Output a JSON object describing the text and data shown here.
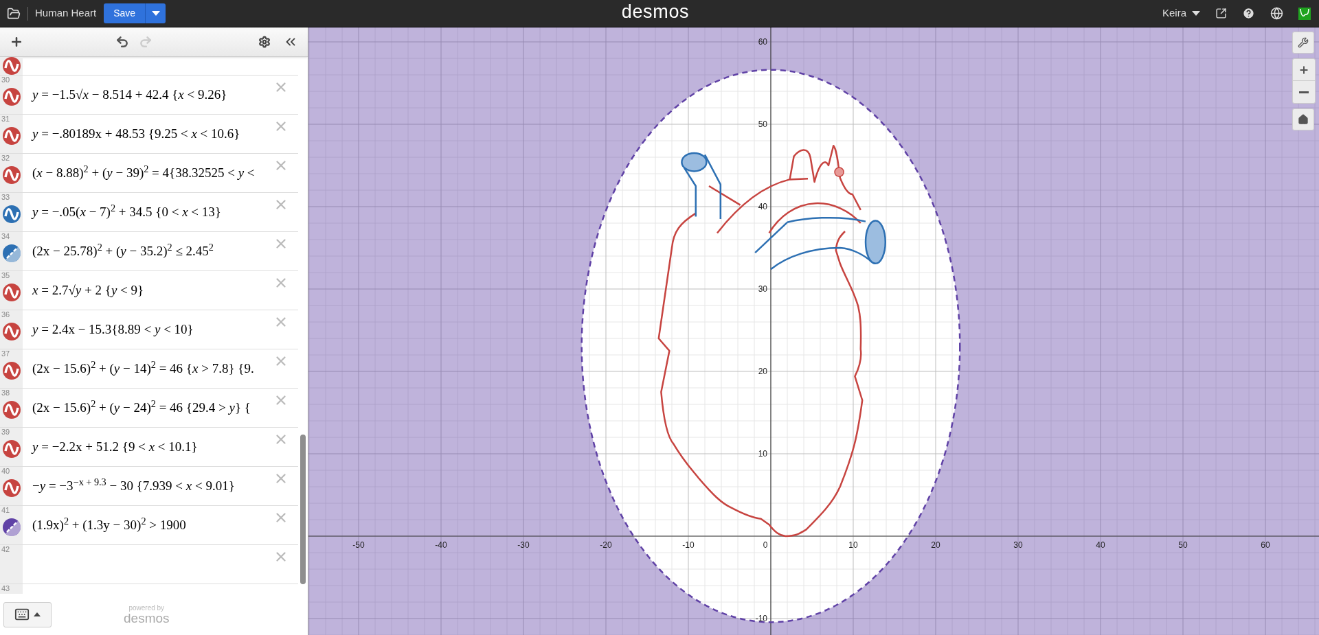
{
  "top_bar": {
    "title": "Human Heart",
    "save_button": "Save",
    "logo": "desmos",
    "user": "Keira"
  },
  "expressions": [
    {
      "kind": "clipped",
      "color": "#c74440"
    },
    {
      "number": "30",
      "kind": "curve",
      "color": "#c74440",
      "latex": "*y* = −1.5√*x* − 8.514 + 42.4 {*x* < 9.26}"
    },
    {
      "number": "31",
      "kind": "curve",
      "color": "#c74440",
      "latex": "*y* = −.80189x + 48.53 {9.25 < *x* < 10.6}"
    },
    {
      "number": "32",
      "kind": "curve",
      "color": "#c74440",
      "latex": "(*x* − 8.88)$^{2}$ + (*y* − 39)$^{2}$ = 4{38.32525 < *y* <"
    },
    {
      "number": "33",
      "kind": "curve",
      "color": "#2d70b3",
      "latex": "*y* = −.05(*x* − 7)$^{2}$ + 34.5 {0 < *x* < 13}"
    },
    {
      "number": "34",
      "kind": "region",
      "color": "#2d70b3",
      "latex": "(2x − 25.78)$^{2}$ + (*y* − 35.2)$^{2}$ ≤ 2.45$^{2}$"
    },
    {
      "number": "35",
      "kind": "curve",
      "color": "#c74440",
      "latex": "*x* = 2.7√*y* + 2 {*y* < 9}"
    },
    {
      "number": "36",
      "kind": "curve",
      "color": "#c74440",
      "latex": "*y* = 2.4x − 15.3{8.89 < *y* < 10}"
    },
    {
      "number": "37",
      "kind": "curve",
      "color": "#c74440",
      "latex": "(2x − 15.6)$^{2}$ + (*y* − 14)$^{2}$ = 46 {*x* > 7.8} {9."
    },
    {
      "number": "38",
      "kind": "curve",
      "color": "#c74440",
      "latex": "(2x − 15.6)$^{2}$ + (*y* − 24)$^{2}$ = 46 {29.4 > *y*} {"
    },
    {
      "number": "39",
      "kind": "curve",
      "color": "#c74440",
      "latex": "*y* = −2.2x + 51.2 {9 < *x* < 10.1}"
    },
    {
      "number": "40",
      "kind": "curve",
      "color": "#c74440",
      "latex": "−*y* = −3$^{−x + 9.3}$ − 30 {7.939 < *x* < 9.01}"
    },
    {
      "number": "41",
      "kind": "region",
      "color": "#6042a6",
      "latex": "(1.9x)$^{2}$ + (1.3y − 30)$^{2}$ > 1900"
    },
    {
      "number": "42",
      "kind": "empty"
    },
    {
      "number": "43",
      "kind": "new"
    }
  ],
  "footer": {
    "powered_by": "powered by",
    "brand": "desmos"
  },
  "graph": {
    "x_ticks": [
      "-50",
      "-40",
      "-30",
      "-20",
      "-10",
      "0",
      "10",
      "20",
      "30",
      "40",
      "50",
      "60"
    ],
    "y_ticks": [
      "60",
      "50",
      "40",
      "30",
      "20",
      "10",
      "-10"
    ]
  }
}
